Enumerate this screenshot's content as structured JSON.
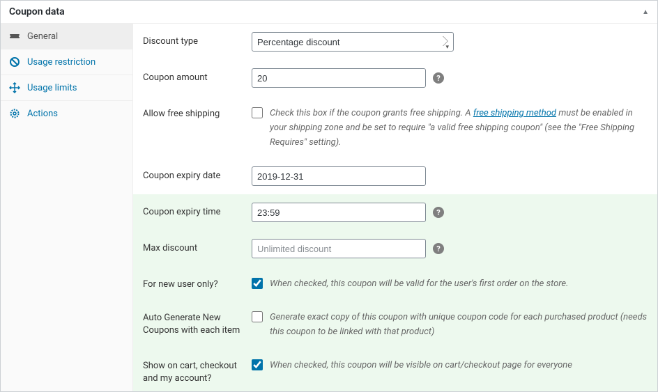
{
  "panel": {
    "title": "Coupon data"
  },
  "sidebar": {
    "tabs": [
      {
        "icon": "ticket",
        "label": "General"
      },
      {
        "icon": "ban",
        "label": "Usage restriction"
      },
      {
        "icon": "move",
        "label": "Usage limits"
      },
      {
        "icon": "gear",
        "label": "Actions"
      }
    ]
  },
  "fields": {
    "discount_type": {
      "label": "Discount type",
      "value": "Percentage discount"
    },
    "coupon_amount": {
      "label": "Coupon amount",
      "value": "20"
    },
    "free_shipping": {
      "label": "Allow free shipping",
      "desc_pre": "Check this box if the coupon grants free shipping. A ",
      "desc_link": "free shipping method",
      "desc_post": " must be enabled in your shipping zone and be set to require \"a valid free shipping coupon\" (see the \"Free Shipping Requires\" setting)."
    },
    "expiry_date": {
      "label": "Coupon expiry date",
      "value": "2019-12-31"
    },
    "expiry_time": {
      "label": "Coupon expiry time",
      "value": "23:59"
    },
    "max_discount": {
      "label": "Max discount",
      "placeholder": "Unlimited discount"
    },
    "new_user": {
      "label": "For new user only?",
      "desc": "When checked, this coupon will be valid for the user's first order on the store."
    },
    "auto_generate": {
      "label": "Auto Generate New Coupons with each item",
      "desc": "Generate exact copy of this coupon with unique coupon code for each purchased product (needs this coupon to be linked with that product)"
    },
    "show_on_cart": {
      "label": "Show on cart, checkout and my account?",
      "desc": "When checked, this coupon will be visible on cart/checkout page for everyone"
    }
  }
}
